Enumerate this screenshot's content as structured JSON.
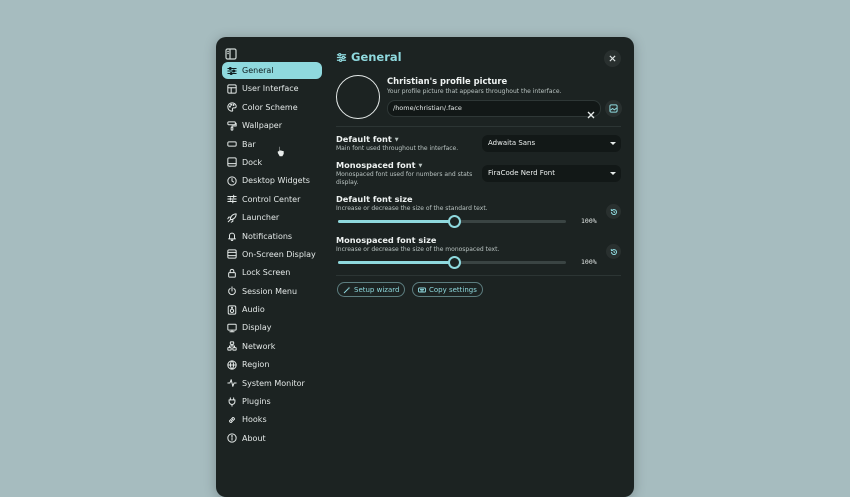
{
  "sidebar": {
    "items": [
      {
        "label": "General",
        "icon": "sliders-icon",
        "active": true
      },
      {
        "label": "User Interface",
        "icon": "layout-icon"
      },
      {
        "label": "Color Scheme",
        "icon": "palette-icon"
      },
      {
        "label": "Wallpaper",
        "icon": "paint-roller-icon"
      },
      {
        "label": "Bar",
        "icon": "bar-icon"
      },
      {
        "label": "Dock",
        "icon": "dock-icon"
      },
      {
        "label": "Desktop Widgets",
        "icon": "clock-icon"
      },
      {
        "label": "Control Center",
        "icon": "control-icon"
      },
      {
        "label": "Launcher",
        "icon": "rocket-icon"
      },
      {
        "label": "Notifications",
        "icon": "bell-icon"
      },
      {
        "label": "On-Screen Display",
        "icon": "osd-icon"
      },
      {
        "label": "Lock Screen",
        "icon": "lock-icon"
      },
      {
        "label": "Session Menu",
        "icon": "power-icon"
      },
      {
        "label": "Audio",
        "icon": "audio-icon"
      },
      {
        "label": "Display",
        "icon": "monitor-icon"
      },
      {
        "label": "Network",
        "icon": "network-icon"
      },
      {
        "label": "Region",
        "icon": "globe-icon"
      },
      {
        "label": "System Monitor",
        "icon": "pulse-icon"
      },
      {
        "label": "Plugins",
        "icon": "plug-icon"
      },
      {
        "label": "Hooks",
        "icon": "link-icon"
      },
      {
        "label": "About",
        "icon": "info-icon"
      }
    ]
  },
  "header": {
    "title": "General"
  },
  "profile": {
    "title": "Christian's profile picture",
    "description": "Your profile picture that appears throughout the interface.",
    "path": "/home/christian/.face"
  },
  "default_font": {
    "title": "Default font",
    "description": "Main font used throughout the interface.",
    "value": "Adwaita Sans"
  },
  "mono_font": {
    "title": "Monospaced font",
    "description": "Monospaced font used for numbers and stats display.",
    "value": "FiraCode Nerd Font"
  },
  "default_font_size": {
    "title": "Default font size",
    "description": "Increase or decrease the size of the standard text.",
    "value_label": "100%",
    "fraction": 0.51
  },
  "mono_font_size": {
    "title": "Monospaced font size",
    "description": "Increase or decrease the size of the monospaced text.",
    "value_label": "100%",
    "fraction": 0.51
  },
  "actions": {
    "setup_wizard": "Setup wizard",
    "copy_settings": "Copy settings"
  },
  "colors": {
    "accent": "#8fd9de",
    "background": "#1c2322",
    "desktop": "#a6bcbf"
  }
}
